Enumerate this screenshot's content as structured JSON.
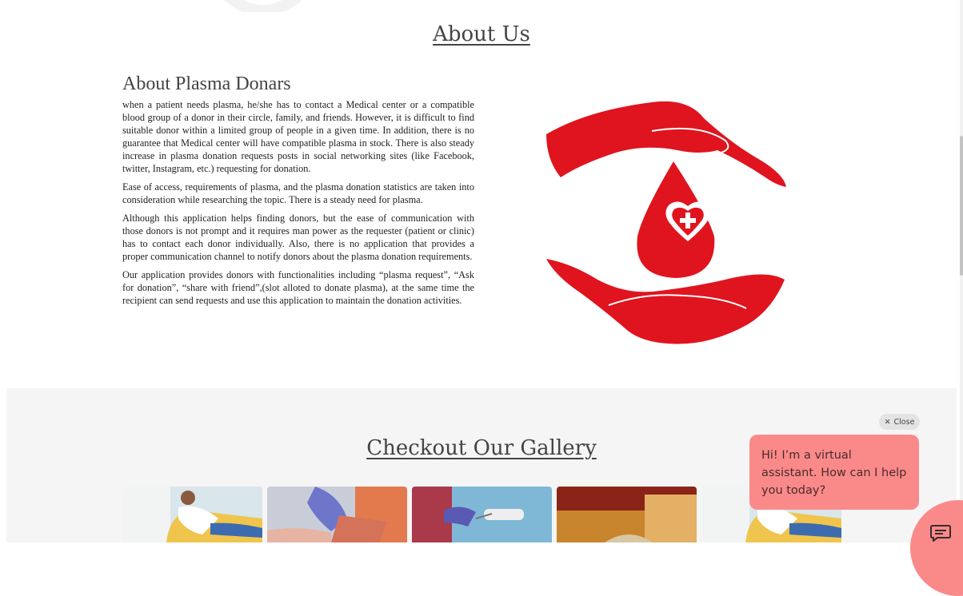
{
  "about": {
    "heading": "About Us",
    "title": "About Plasma Donars",
    "paragraphs": [
      "when a patient needs plasma, he/she has to contact a Medical center or a compatible blood group of a donor in their circle, family, and friends. However, it is difficult to find suitable donor within a limited group of people in a given time. In addition, there is no guarantee that Medical center will have compatible plasma in stock. There is also steady increase in plasma donation requests posts in social networking sites (like Facebook, twitter, Instagram, etc.) requesting for donation.",
      "Ease of access, requirements of plasma, and the plasma donation statistics are taken into consideration while researching the topic. There is a steady need for plasma.",
      "Although this application helps finding donors, but the ease of communication with those donors is not prompt and it requires man power as the requester (patient or clinic) has to contact each donor individually. Also, there is no application that provides a proper communication channel to notify donors about the plasma donation requirements.",
      "Our application provides donors with functionalities including “plasma request”, “Ask for donation”, “share with friend”,(slot alloted to donate plasma), at the same time the recipient can send requests and use this application to maintain the donation activities."
    ],
    "logo_icon": "hands-blood-drop-heart-icon"
  },
  "gallery": {
    "heading": "Checkout Our Gallery",
    "images": [
      "donor-reclining-photo",
      "gloved-hands-plasma-bag-photo",
      "needle-arm-photo",
      "blurred-clinic-photo",
      "donor-reclining-photo"
    ]
  },
  "chat": {
    "close_label": "Close",
    "message": "Hi! I’m a virtual assistant. How can I help you today?",
    "launcher_icon": "chat-message-icon"
  },
  "colors": {
    "brand_red": "#e0141e",
    "chat_bg": "#fa8a8a",
    "gallery_bg": "#f5f5f5"
  }
}
